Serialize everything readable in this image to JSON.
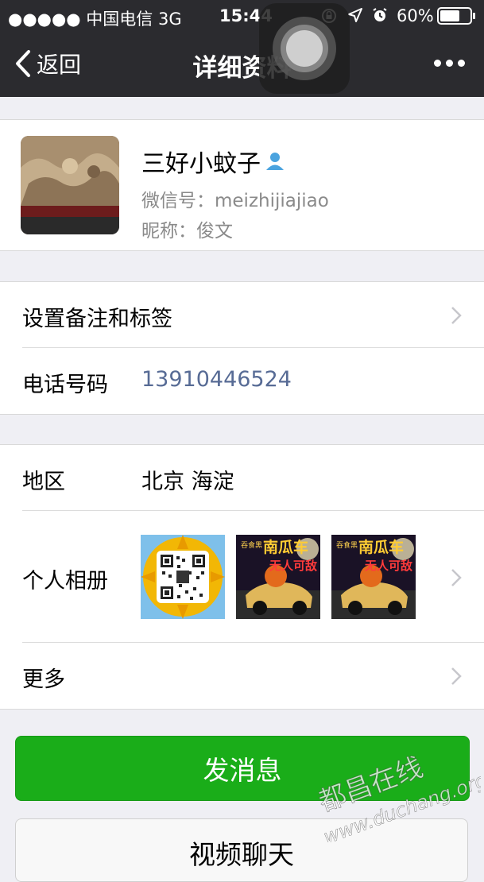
{
  "status_bar": {
    "carrier": "●●●●● 中国电信  3G",
    "time": "15:44",
    "battery": "60%"
  },
  "nav": {
    "back_label": "返回",
    "title": "详细资料"
  },
  "profile": {
    "name": "三好小蚊子",
    "wechat_id": "微信号：meizhijiajiao",
    "nickname": "昵称：俊文"
  },
  "rows": {
    "remark_label": "设置备注和标签",
    "phone_label": "电话号码",
    "phone_value": "13910446524",
    "region_label": "地区",
    "region_value": "北京 海淀",
    "album_label": "个人相册",
    "more_label": "更多"
  },
  "album": {
    "photo2_text1": "吞食黑",
    "photo2_text2": "南瓜车",
    "photo2_text3": "无人可敌",
    "photo3_text1": "吞食黑",
    "photo3_text2": "南瓜车",
    "photo3_text3": "无人可敌"
  },
  "actions": {
    "send_message": "发消息",
    "video_chat": "视频聊天"
  },
  "watermark": {
    "cn": "都昌在线",
    "url": "www.duchang.org"
  },
  "colors": {
    "nav_bg": "#2b2b2f",
    "accent_green": "#1aad19",
    "phone_link": "#576b95",
    "page_bg": "#efeff4"
  },
  "icons": [
    "chevron-left-icon",
    "more-dots-icon",
    "person-icon",
    "chevron-right-icon",
    "lock-rotation-icon",
    "location-arrow-icon",
    "alarm-icon",
    "battery-icon",
    "assistive-touch-icon"
  ]
}
